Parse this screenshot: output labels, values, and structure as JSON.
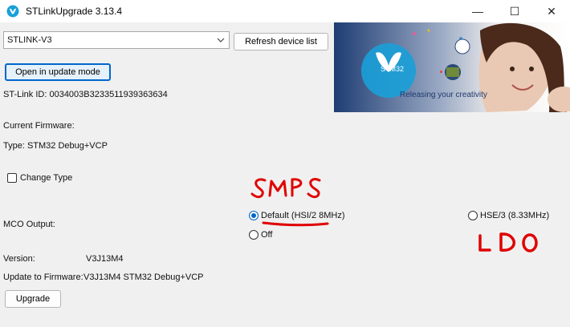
{
  "window": {
    "title": "STLinkUpgrade 3.13.4",
    "controls": {
      "minimize": "—",
      "maximize": "☐",
      "close": "✕"
    }
  },
  "device": {
    "selected": "STLINK-V3",
    "refresh_label": "Refresh device list",
    "update_mode_label": "Open in update mode",
    "stlink_id": "ST-Link ID: 0034003B3233511939363634"
  },
  "banner": {
    "logo_text": "STM32",
    "tagline": "Releasing your creativity"
  },
  "firmware": {
    "current_label": "Current Firmware:",
    "type_label": "Type: STM32 Debug+VCP"
  },
  "change_type": {
    "label": "Change Type",
    "checked": false
  },
  "mco": {
    "label": "MCO Output:",
    "options": [
      {
        "label": "Default (HSI/2 8MHz)",
        "selected": true
      },
      {
        "label": "Off",
        "selected": false
      },
      {
        "label": "HSE/3 (8.33MHz)",
        "selected": false
      }
    ]
  },
  "version": {
    "label": "Version:",
    "value": "V3J13M4"
  },
  "update_to": {
    "label": "Update to Firmware:",
    "value": "V3J13M4  STM32 Debug+VCP"
  },
  "upgrade_label": "Upgrade",
  "annotations": {
    "smps": "SMPS",
    "ldo": "LDO",
    "ink_color": "#e00000"
  },
  "colors": {
    "accent": "#0066cc",
    "background": "#f0f0f0"
  }
}
